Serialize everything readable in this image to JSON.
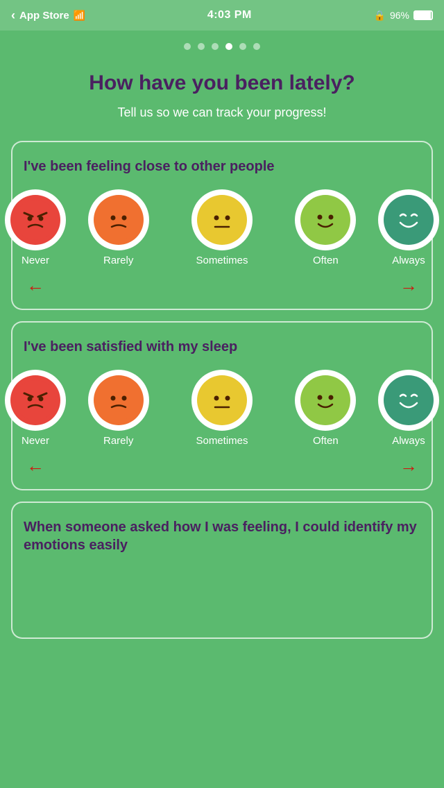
{
  "statusBar": {
    "appStore": "App Store",
    "time": "4:03 PM",
    "battery": "96%"
  },
  "pageDots": {
    "total": 6,
    "activeIndex": 3
  },
  "header": {
    "question": "How have you been lately?",
    "subtext": "Tell us so we can track your progress!"
  },
  "cards": [
    {
      "title": "I've been feeling close to other people",
      "options": [
        {
          "label": "Never",
          "emoji": "😠",
          "faceClass": "face-never"
        },
        {
          "label": "Rarely",
          "emoji": "🙁",
          "faceClass": "face-rarely"
        },
        {
          "label": "Sometimes",
          "emoji": "😐",
          "faceClass": "face-sometimes"
        },
        {
          "label": "Often",
          "emoji": "🙂",
          "faceClass": "face-often"
        },
        {
          "label": "Always",
          "emoji": "😄",
          "faceClass": "face-always"
        }
      ]
    },
    {
      "title": "I've been satisfied with my sleep",
      "options": [
        {
          "label": "Never",
          "emoji": "😠",
          "faceClass": "face-never"
        },
        {
          "label": "Rarely",
          "emoji": "🙁",
          "faceClass": "face-rarely"
        },
        {
          "label": "Sometimes",
          "emoji": "😐",
          "faceClass": "face-sometimes"
        },
        {
          "label": "Often",
          "emoji": "🙂",
          "faceClass": "face-often"
        },
        {
          "label": "Always",
          "emoji": "😄",
          "faceClass": "face-always"
        }
      ]
    },
    {
      "title": "When someone asked how I was feeling, I could identify my emotions easily"
    }
  ],
  "arrows": {
    "left": "←",
    "right": "→"
  }
}
